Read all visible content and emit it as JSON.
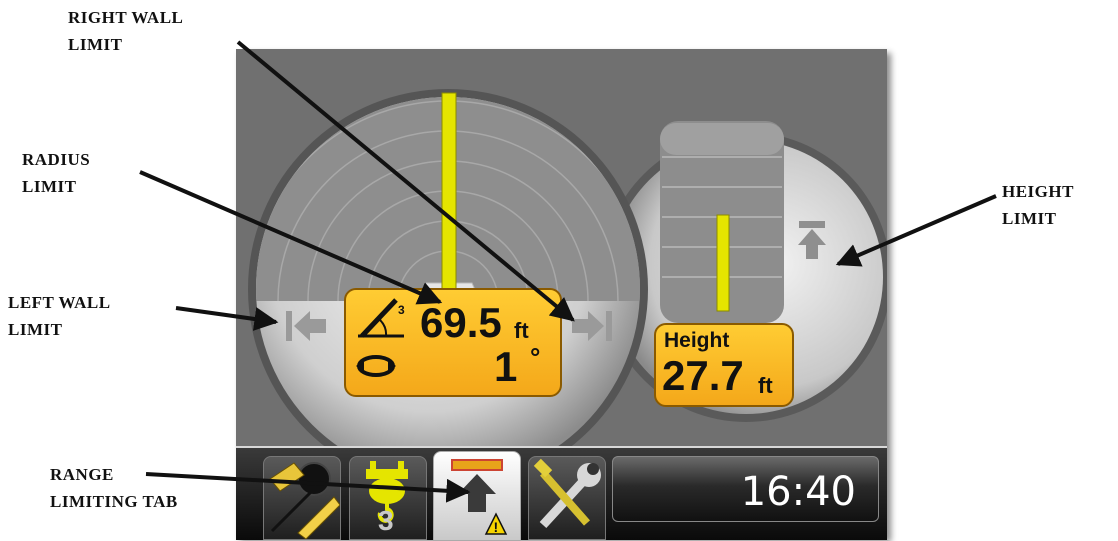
{
  "callouts": {
    "right_wall": [
      "RIGHT WALL",
      "LIMIT"
    ],
    "radius": [
      "RADIUS",
      "LIMIT"
    ],
    "left_wall": [
      "LEFT WALL",
      "LIMIT"
    ],
    "height": [
      "HEIGHT",
      "LIMIT"
    ],
    "range_tab": [
      "RANGE",
      "LIMITING TAB"
    ]
  },
  "radius_readout": {
    "radius_value": "69.5",
    "radius_unit": "ft",
    "swing_value": "1",
    "swing_unit": "°"
  },
  "height_readout": {
    "label": "Height",
    "value": "27.7",
    "unit": "ft"
  },
  "tabs": {
    "hook_number": "3"
  },
  "clock": "16:40",
  "colors": {
    "accent_yellow": "#e5e500",
    "readout_orange": "#f7b526",
    "limit_gray": "#8c8c8c",
    "screen_gray": "#6f6f6f"
  },
  "icons": [
    "capacity-ruler-icon",
    "hook-block-icon",
    "range-limit-warning-icon",
    "tools-wrench-icon",
    "boom-angle-icon",
    "swing-rotation-icon",
    "left-wall-arrow-icon",
    "right-wall-arrow-icon",
    "radius-limit-arrow-icon",
    "height-limit-arrow-icon"
  ]
}
